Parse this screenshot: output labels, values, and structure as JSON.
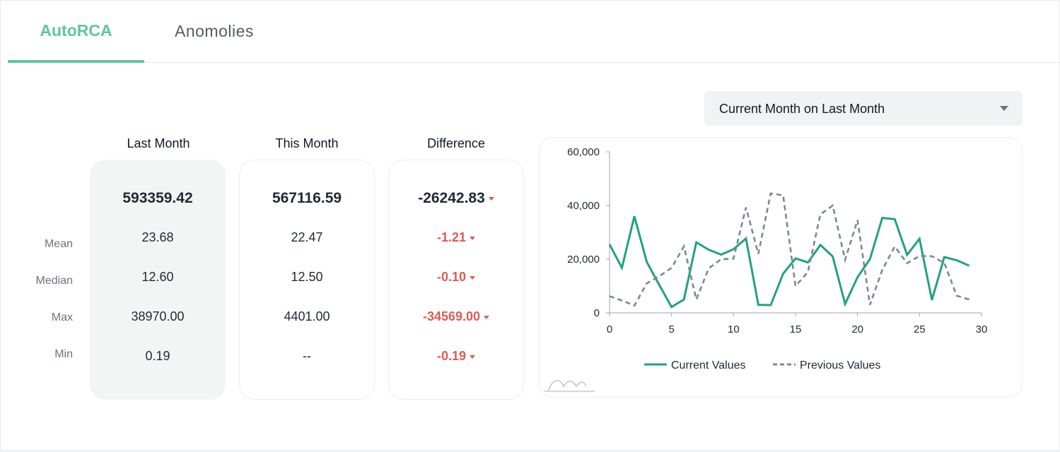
{
  "tabs": [
    {
      "label": "AutoRCA",
      "active": true
    },
    {
      "label": "Anomolies",
      "active": false
    }
  ],
  "dropdown": {
    "selected": "Current Month on Last Month"
  },
  "row_labels": [
    "Mean",
    "Median",
    "Max",
    "Min"
  ],
  "columns": {
    "last_month": {
      "header": "Last Month",
      "total": "593359.42",
      "values": [
        "23.68",
        "12.60",
        "38970.00",
        "0.19"
      ]
    },
    "this_month": {
      "header": "This Month",
      "total": "567116.59",
      "values": [
        "22.47",
        "12.50",
        "4401.00",
        "--"
      ]
    },
    "difference": {
      "header": "Difference",
      "total": "-26242.83",
      "values": [
        "-1.21",
        "-0.10",
        "-34569.00",
        "-0.19"
      ]
    }
  },
  "colors": {
    "accent": "#5cc89a",
    "negative": "#e05a55",
    "current_series": "#22a37a",
    "previous_series": "#7b8798"
  },
  "chart_data": {
    "type": "line",
    "xlim": [
      0,
      30
    ],
    "ylim": [
      0,
      60000
    ],
    "xticks": [
      "0",
      "5",
      "10",
      "15",
      "20",
      "25",
      "30"
    ],
    "yticks": [
      "0",
      "20,000",
      "40,000",
      "60,000"
    ],
    "grid": false,
    "legend_position": "bottom",
    "series": [
      {
        "name": "Current Values",
        "style": "solid",
        "x": [
          0,
          1,
          2,
          3,
          4,
          5,
          6,
          7,
          8,
          9,
          10,
          11,
          12,
          13,
          14,
          15,
          16,
          17,
          18,
          19,
          20,
          21,
          22,
          23,
          24,
          25,
          26,
          27,
          28,
          29
        ],
        "values": [
          25500,
          16800,
          36000,
          19000,
          10500,
          2200,
          5000,
          26300,
          23500,
          21700,
          23700,
          27700,
          3000,
          2900,
          14600,
          20300,
          18800,
          25300,
          21000,
          3300,
          13300,
          20000,
          35400,
          34900,
          21600,
          27600,
          4800,
          20800,
          19600,
          17600
        ]
      },
      {
        "name": "Previous Values",
        "style": "dashed",
        "x": [
          0,
          1,
          2,
          3,
          4,
          5,
          6,
          7,
          8,
          9,
          10,
          11,
          12,
          13,
          14,
          15,
          16,
          17,
          18,
          19,
          20,
          21,
          22,
          23,
          24,
          25,
          26,
          27,
          28,
          29
        ],
        "values": [
          6200,
          4600,
          2700,
          11000,
          13600,
          16800,
          24800,
          5000,
          16600,
          20000,
          20200,
          39300,
          22000,
          44500,
          43800,
          10000,
          15200,
          36700,
          40000,
          19800,
          34600,
          3000,
          16000,
          24700,
          18500,
          21200,
          21100,
          18600,
          6400,
          5000
        ]
      }
    ]
  }
}
